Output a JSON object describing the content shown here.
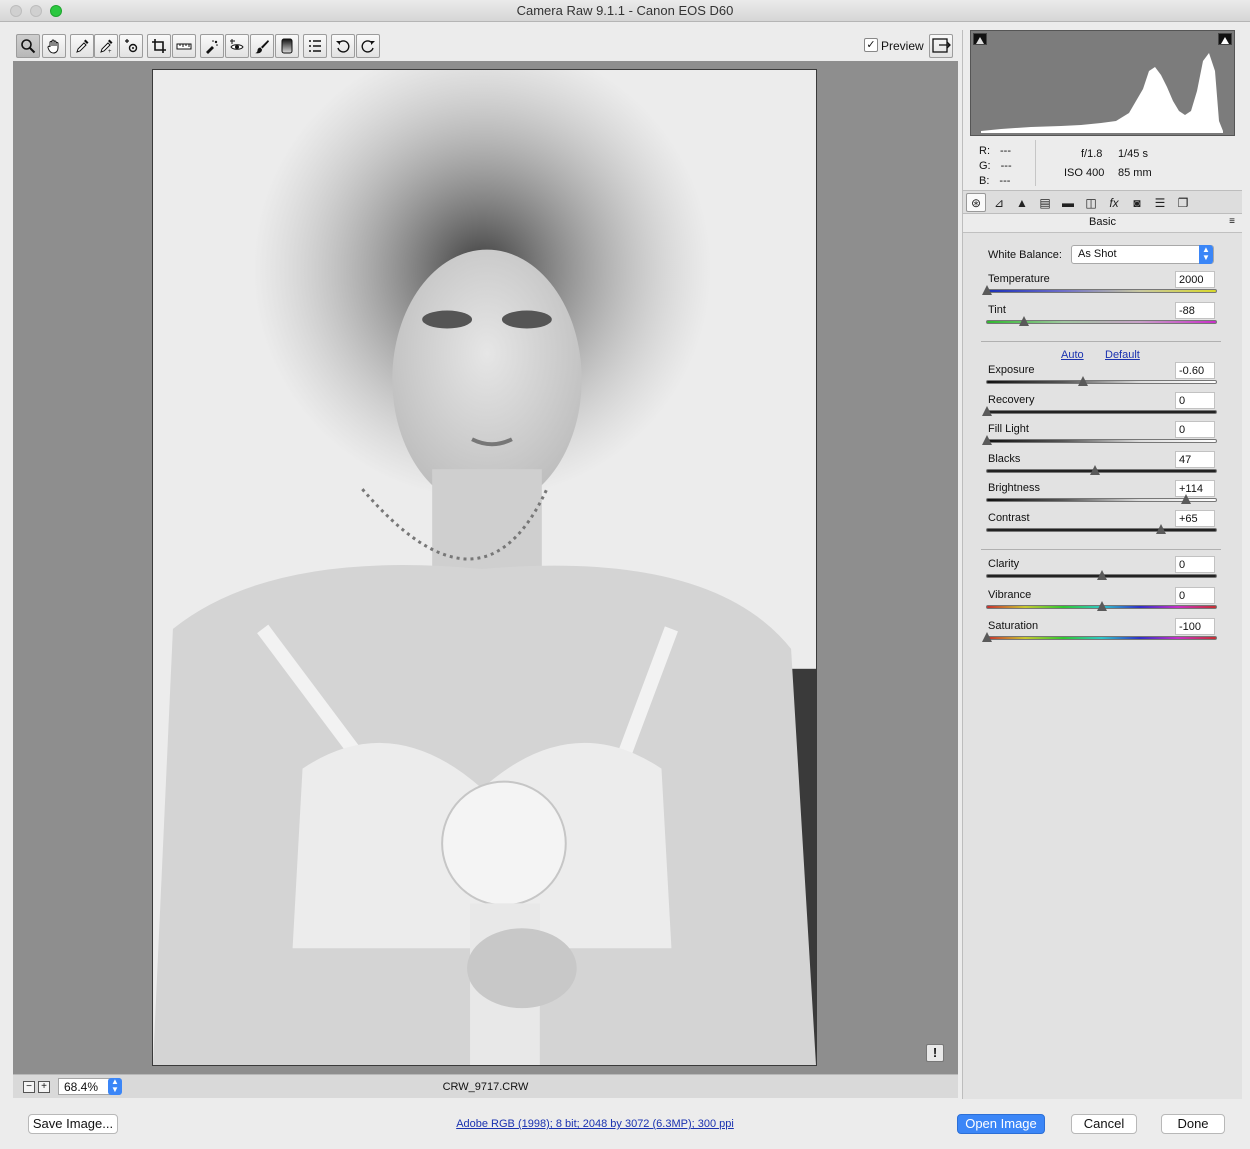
{
  "window": {
    "title": "Camera Raw 9.1.1  -  Canon EOS D60"
  },
  "toolbar": {
    "tools": [
      "zoom-icon",
      "hand-icon",
      "white-balance-eyedropper-icon",
      "color-sampler-icon",
      "targeted-adjustment-icon",
      "crop-icon",
      "straighten-icon",
      "spot-removal-icon",
      "red-eye-icon",
      "adjustment-brush-icon",
      "graduated-filter-icon",
      "preferences-icon",
      "rotate-left-icon",
      "rotate-right-icon"
    ],
    "preview_label": "Preview",
    "preview_checked": "✓"
  },
  "image": {
    "warning": "!"
  },
  "statusbar": {
    "zoom": "68.4%",
    "filename": "CRW_9717.CRW",
    "zoom_out": "−",
    "zoom_in": "+"
  },
  "readout": {
    "r_label": "R:",
    "r": "---",
    "g_label": "G:",
    "g": "---",
    "b_label": "B:",
    "b": "---",
    "aperture": "f/1.8",
    "shutter": "1/45 s",
    "iso": "ISO 400",
    "focal": "85 mm"
  },
  "panel": {
    "title": "Basic",
    "menu_glyph": "≡",
    "white_balance_label": "White Balance:",
    "white_balance_value": "As Shot",
    "auto": "Auto",
    "default": "Default"
  },
  "sliders": [
    {
      "label": "Temperature",
      "value": "2000",
      "position": 0.0,
      "track": "temp"
    },
    {
      "label": "Tint",
      "value": "-88",
      "position": 0.16,
      "track": "tint"
    },
    {
      "label": "Exposure",
      "value": "-0.60",
      "position": 0.42,
      "track": "white"
    },
    {
      "label": "Recovery",
      "value": "0",
      "position": 0.0,
      "track": "dark"
    },
    {
      "label": "Fill Light",
      "value": "0",
      "position": 0.0,
      "track": "white"
    },
    {
      "label": "Blacks",
      "value": "47",
      "position": 0.47,
      "track": "dark"
    },
    {
      "label": "Brightness",
      "value": "+114",
      "position": 0.87,
      "track": "white"
    },
    {
      "label": "Contrast",
      "value": "+65",
      "position": 0.76,
      "track": "dark"
    },
    {
      "label": "Clarity",
      "value": "0",
      "position": 0.5,
      "track": "dark"
    },
    {
      "label": "Vibrance",
      "value": "0",
      "position": 0.5,
      "track": "rainbow"
    },
    {
      "label": "Saturation",
      "value": "-100",
      "position": 0.0,
      "track": "rainbow"
    }
  ],
  "bottom": {
    "save_label": "Save Image...",
    "info": "Adobe RGB (1998); 8 bit; 2048 by 3072 (6.3MP); 300 ppi",
    "open_label": "Open Image",
    "cancel_label": "Cancel",
    "done_label": "Done"
  },
  "colors": {
    "accent": "#3b86f7",
    "link": "#1a32b0"
  }
}
